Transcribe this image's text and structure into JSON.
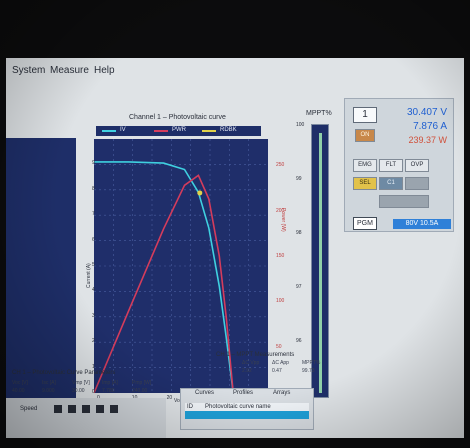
{
  "menu": [
    "System",
    "Measure",
    "Help"
  ],
  "chart": {
    "title": "Channel 1 – Photovoltaic curve",
    "legend": [
      {
        "label": "IV",
        "color": "#3fd0e0"
      },
      {
        "label": "PWR",
        "color": "#d43c5c"
      },
      {
        "label": "RDBK",
        "color": "#e0d24a"
      }
    ],
    "xlabel": "Voltage (V)",
    "ylabel_left": "Current (A)",
    "ylabel_right": "Power (W)",
    "x_ticks": [
      "0",
      "10",
      "20",
      "30",
      "40"
    ],
    "y_ticks_left": [
      "0",
      "1",
      "2",
      "3",
      "4",
      "5",
      "6",
      "7",
      "8",
      "9"
    ],
    "y_ticks_right": [
      "0",
      "50",
      "100",
      "150",
      "200",
      "250"
    ]
  },
  "chart_data": {
    "type": "line",
    "xlim": [
      0,
      50
    ],
    "ylim_left": [
      0,
      10
    ],
    "ylim_right": [
      0,
      280
    ],
    "series": [
      {
        "name": "IV",
        "axis": "left",
        "points": [
          [
            0,
            9.1
          ],
          [
            10,
            9.1
          ],
          [
            20,
            9.05
          ],
          [
            26,
            8.8
          ],
          [
            30,
            7.9
          ],
          [
            33,
            6.5
          ],
          [
            36,
            4.2
          ],
          [
            38,
            2.2
          ],
          [
            40,
            0
          ]
        ]
      },
      {
        "name": "PWR",
        "axis": "right",
        "points": [
          [
            0,
            0
          ],
          [
            10,
            91
          ],
          [
            20,
            181
          ],
          [
            26,
            229
          ],
          [
            30,
            240
          ],
          [
            33,
            214
          ],
          [
            36,
            151
          ],
          [
            38,
            84
          ],
          [
            40,
            0
          ]
        ]
      }
    ],
    "readback_point": {
      "x": 30.4,
      "y": 7.876
    }
  },
  "mppt": {
    "title": "MPPT%",
    "ticks": [
      "100",
      "99",
      "98",
      "97",
      "96",
      "95"
    ],
    "value_percent": 99
  },
  "control": {
    "channel": "1",
    "voltage": "30.407",
    "voltage_unit": "V",
    "current": "7.876",
    "current_unit": "A",
    "power": "239.37",
    "power_unit": "W",
    "on_label": "ON",
    "emg_label": "EMG",
    "flt_label": "FLT",
    "ovp_label": "OVP",
    "sel_label": "SEL",
    "c1_label": "C1",
    "pgm_label": "PGM",
    "range_label": "80V 10.5A",
    "colors": {
      "voltage": "#1f5fd0",
      "current": "#1f5fd0",
      "power": "#d0503a"
    }
  },
  "params": {
    "title": "CH 1 – Photovoltaic Curve Parameters",
    "headers": [
      "Voc [V]",
      "Isc [A]",
      "Vmp [V]",
      "Imp [A]",
      "Pmp [W]"
    ],
    "values": [
      "40.00",
      "9.000",
      "30.00",
      "7.780",
      "240.00"
    ]
  },
  "mppt_meas": {
    "title": "CH 1 – MPPT Measurements",
    "headers": [
      "ΔC Vpp",
      "ΔC App",
      "MPPT%"
    ],
    "values": [
      "2.92",
      "0.47",
      "99.73"
    ]
  },
  "tabs": [
    "Curves",
    "Profiles",
    "Arrays"
  ],
  "list_row": {
    "id": "ID",
    "name": "Photovoltaic curve name"
  },
  "speed_label": "Speed"
}
